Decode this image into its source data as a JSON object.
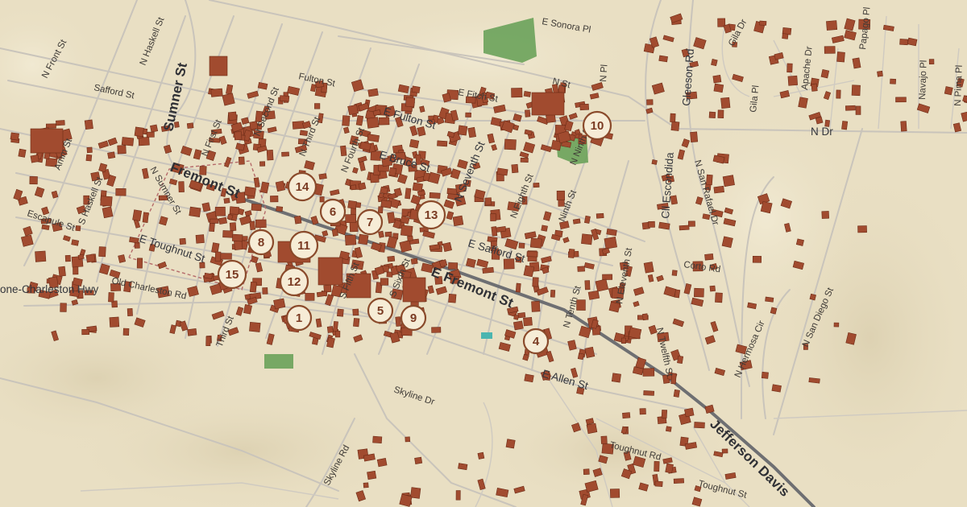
{
  "map": {
    "colors": {
      "background": "#e9dfc3",
      "building": "#a14b2f",
      "street": "#c9c4bb",
      "highway": "#6e6f72",
      "park": "#6aa25a",
      "marker_fill": "#f6ecd6",
      "marker_stroke": "#8a4a2b",
      "label": "#3e3a36"
    },
    "major_roads": {
      "sumner": "Sumner St",
      "fremont_w": "Fremont St",
      "fremont_e": "E Fremont St",
      "jefferson": "Jefferson Davis"
    },
    "street_labels": {
      "n_front": "N Front St",
      "n_haskell_top": "N Haskell St",
      "safford": "Safford St",
      "fulton": "Fulton St",
      "n_second": "N Second St",
      "n_first": "N First St",
      "n_third": "N Third St",
      "n_fourth": "N Fourth St",
      "e_fulton": "E Fulton St",
      "e_fitch": "E Fitch St",
      "e_sonora": "E Sonora Pl",
      "n_st": "N St",
      "n_pl": "N Pl",
      "amm": "Amm St",
      "s_haskell": "S Haskell St",
      "n_sumner": "N Sumner St",
      "escapule": "Escapule St",
      "e_toughnut": "E Toughnut St",
      "old_charleston": "Old Charleston Rd",
      "tombstone_charleston": "one-Charleston Hwy",
      "third": "Third St",
      "s_fifth": "S Fifth St",
      "s_sixth": "S Sixth St",
      "e_bruce": "E Bruce St",
      "n_seventh": "N Seventh St",
      "n_eighth": "N Eighth St",
      "ninth": "Ninth St",
      "n_ninth": "N Ninth St",
      "e_safford": "E Safford St",
      "n_eleventh": "N Eleventh St",
      "n_twelfth": "N Twelfth St",
      "n_tenth": "N Tenth St",
      "e_allen": "E Allen St",
      "skyline": "Skyline Dr",
      "skyline_rd": "Skyline Rd",
      "toughnut_rd": "Toughnut Rd",
      "toughnut_st": "Toughnut St",
      "cll_escondida": "Cll Escondida",
      "gleeson": "Gleeson Rd",
      "n_san_rafael": "N San Rafael Dr",
      "corto": "Corto Rd",
      "n_hermosa": "N Hermosa Cir",
      "n_san_diego": "N San Diego St",
      "gila_dr": "Gila Dr",
      "gila_pl": "Gila Pl",
      "apache": "Apache Dr",
      "papago": "Papago Pl",
      "navajo": "Navajo Pl",
      "n_pima": "N Pima Pl",
      "n_dr": "N Dr"
    },
    "markers": [
      {
        "number": "1"
      },
      {
        "number": "4"
      },
      {
        "number": "5"
      },
      {
        "number": "6"
      },
      {
        "number": "7"
      },
      {
        "number": "8"
      },
      {
        "number": "9"
      },
      {
        "number": "10"
      },
      {
        "number": "11"
      },
      {
        "number": "12"
      },
      {
        "number": "13"
      },
      {
        "number": "14"
      },
      {
        "number": "15"
      }
    ]
  }
}
